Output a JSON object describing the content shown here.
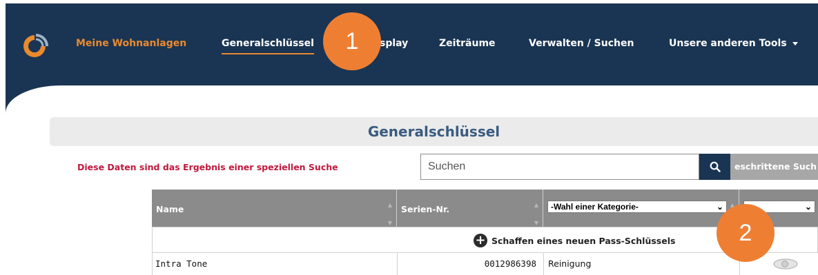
{
  "nav": {
    "items": [
      {
        "label": "Meine Wohnanlagen"
      },
      {
        "label": "Generalschlüssel"
      },
      {
        "label": "splay"
      },
      {
        "label": "Zeiträume"
      },
      {
        "label": "Verwalten / Suchen"
      },
      {
        "label": "Unsere anderen Tools"
      }
    ]
  },
  "callouts": [
    "1",
    "2"
  ],
  "page": {
    "title": "Generalschlüssel",
    "info": "Diese Daten sind das Ergebnis einer speziellen Suche"
  },
  "search": {
    "placeholder": "Suchen",
    "advanced_label": "eschrittene Such"
  },
  "table": {
    "headers": {
      "name": "Name",
      "serial": "Serien-Nr.",
      "category_select": "-Wahl einer Kategorie-"
    },
    "create_label": "Schaffen eines neuen Pass-Schlüssels",
    "rows": [
      {
        "name": "Intra Tone",
        "serial": "0012986398",
        "category": "Reinigung"
      }
    ]
  },
  "colors": {
    "navbar": "#1a3553",
    "accent": "#e98a2f",
    "callout": "#ee7f32",
    "title": "#3a5b80",
    "info": "#c0183c"
  },
  "icons": [
    "logo-icon",
    "search-icon",
    "caret-down-icon",
    "plus-circle-icon",
    "eye-icon",
    "chevron-down-icon",
    "sort-icon"
  ]
}
